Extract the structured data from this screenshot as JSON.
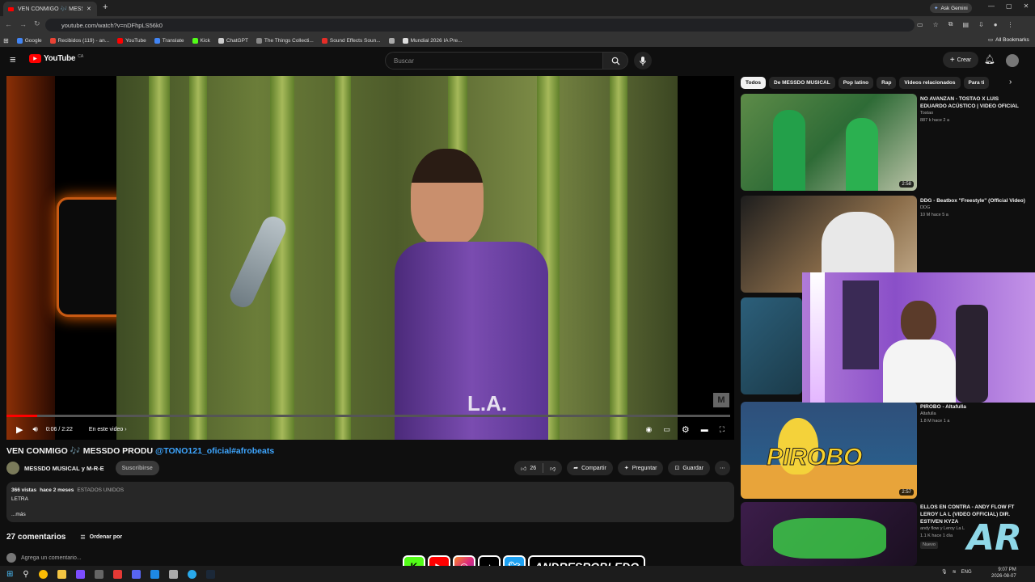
{
  "browser": {
    "tab_title": "VEN CONMIGO 🎶 MESSDO P",
    "url": "youtube.com/watch?v=nDFhpLS56k0",
    "ask_gemini": "Ask Gemini",
    "all_bookmarks": "All Bookmarks",
    "bookmarks": [
      {
        "label": "Google",
        "color": "#4285f4"
      },
      {
        "label": "Recibidos (119) - an...",
        "color": "#ea4335"
      },
      {
        "label": "YouTube",
        "color": "#ff0000"
      },
      {
        "label": "Translate",
        "color": "#4285f4"
      },
      {
        "label": "Kick",
        "color": "#53fc18"
      },
      {
        "label": "ChatGPT",
        "color": "#cccccc"
      },
      {
        "label": "The Things Collecti...",
        "color": "#888888"
      },
      {
        "label": "Sound Effects Soun...",
        "color": "#e52d27"
      },
      {
        "label": "",
        "color": "#aaaaaa"
      },
      {
        "label": "Mundial 2026 IA Pre...",
        "color": "#dddddd"
      }
    ]
  },
  "header": {
    "logo": "YouTube",
    "country": "CA",
    "search_placeholder": "Buscar",
    "create": "Crear"
  },
  "player": {
    "time": "0:06 / 2:22",
    "in_video": "En este video",
    "progress_fraction": 0.042,
    "watermark": "M"
  },
  "video": {
    "title_text": "VEN CONMIGO 🎶 MESSDO PRODU ",
    "title_link": "@TONO121_oficial#afrobeats",
    "channel": "MESSDO MUSICAL y M-R-E",
    "subscribe": "Suscribirse",
    "likes": "26",
    "share": "Compartir",
    "ask": "Preguntar",
    "save": "Guardar",
    "views": "366 vistas",
    "ago": "hace 2 meses",
    "location": "ESTADOS UNIDOS",
    "desc_line": "LETRA",
    "more": "...más",
    "comments_count": "27 comentarios",
    "sort": "Ordenar por",
    "add_comment": "Agrega un comentario..."
  },
  "chips": [
    "Todos",
    "De MESSDO MUSICAL",
    "Pop latino",
    "Rap",
    "Videos relacionados",
    "Para ti"
  ],
  "recommendations": [
    {
      "title": "NO AVANZAN - TOSTAO X LUIS EDUARDO ACÚSTICO | VIDEO OFICIAL",
      "channel": "Tostao",
      "meta": "887 k  hace 2 a",
      "duration": "2:58",
      "thumb": "#3f7a3a"
    },
    {
      "title": "DDG - Beatbox \"Freestyle\" (Official Video)",
      "channel": "DDG",
      "meta": "10 M  hace 5 a",
      "duration": "",
      "thumb": "#7b6a55"
    },
    {
      "title": "",
      "channel": "",
      "meta": "",
      "duration": "",
      "thumb": "#2c5f7a"
    },
    {
      "title": "PIROBO - Altafulla",
      "channel": "Altafulla",
      "meta": "1.8 M  hace 1 a",
      "duration": "2:57",
      "thumb": "#2f4f7a"
    },
    {
      "title": "ELLOS EN CONTRA - ANDY FLOW FT LEROY LA L (VIDEO OFFICIAL) DIR. ESTIVEN KYZA",
      "channel": "andy flow y Leroy La L",
      "meta": "1.1 K  hace 1 día",
      "badge": "Nuevo",
      "duration": "",
      "thumb": "#3c1d4a"
    }
  ],
  "overlay": {
    "handle": "ANDRESROBLEDO",
    "logo_text": "AR",
    "pirobo_text": "PIROBO"
  },
  "taskbar": {
    "lang": "ENG",
    "time": "9:07 PM",
    "date": "2026-08-07"
  }
}
